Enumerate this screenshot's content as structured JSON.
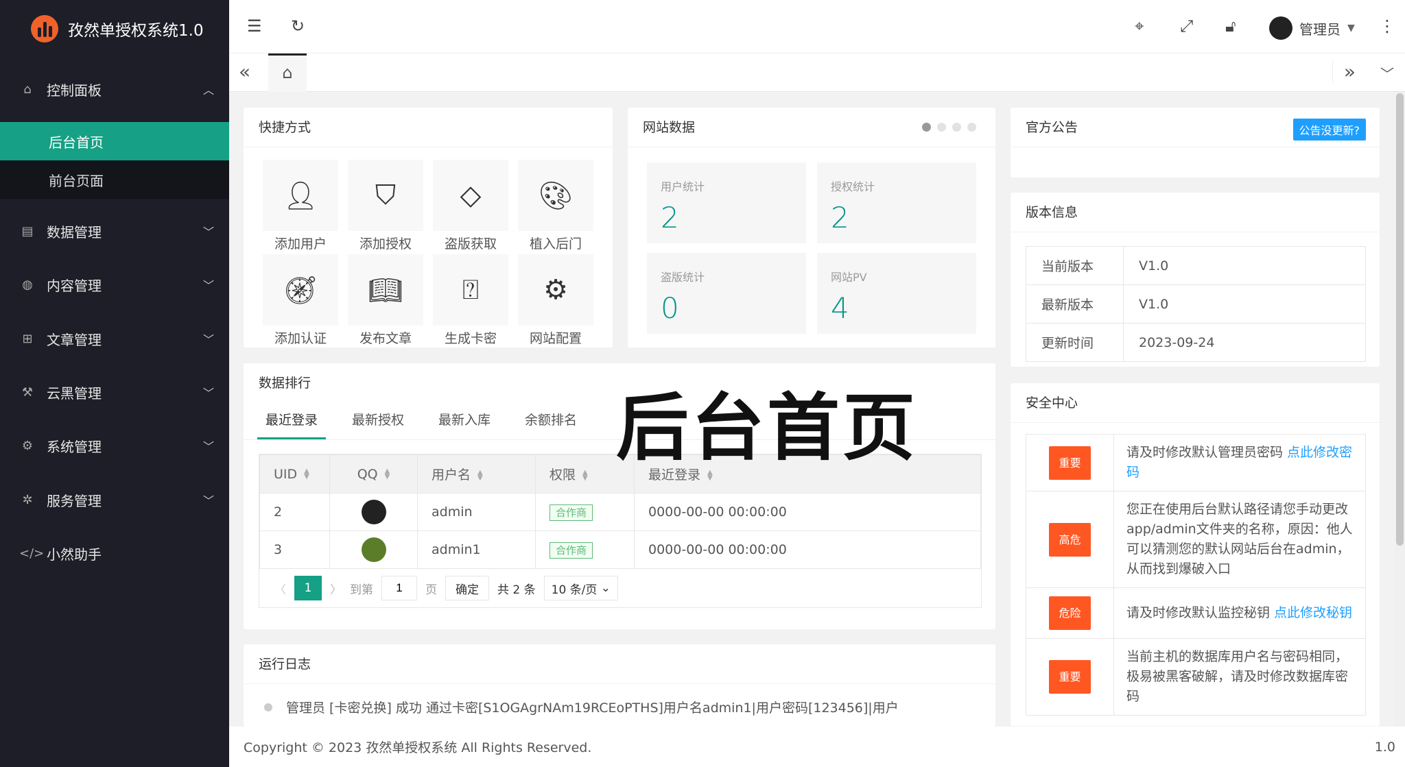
{
  "app": {
    "title": "孜然单授权系统1.0"
  },
  "sidebar": {
    "group": {
      "label": "控制面板",
      "icon": "home-icon"
    },
    "sub_items": [
      {
        "label": "后台首页",
        "active": true
      },
      {
        "label": "前台页面",
        "active": false
      }
    ],
    "items": [
      {
        "label": "数据管理",
        "icon": "file-icon"
      },
      {
        "label": "内容管理",
        "icon": "globe-icon"
      },
      {
        "label": "文章管理",
        "icon": "book-icon"
      },
      {
        "label": "云黑管理",
        "icon": "hammer-icon"
      },
      {
        "label": "系统管理",
        "icon": "gear-icon"
      },
      {
        "label": "服务管理",
        "icon": "service-icon"
      },
      {
        "label": "小然助手",
        "icon": "code-icon"
      }
    ]
  },
  "header": {
    "user": "管理员"
  },
  "quick": {
    "title": "快捷方式",
    "items": [
      {
        "label": "添加用户",
        "icon": "user-icon"
      },
      {
        "label": "添加授权",
        "icon": "shield-check-icon"
      },
      {
        "label": "盗版获取",
        "icon": "diamond-icon"
      },
      {
        "label": "植入后门",
        "icon": "palette-icon"
      },
      {
        "label": "添加认证",
        "icon": "compass-icon"
      },
      {
        "label": "发布文章",
        "icon": "book-open-icon"
      },
      {
        "label": "生成卡密",
        "icon": "question-edit-icon"
      },
      {
        "label": "网站配置",
        "icon": "gear-icon"
      }
    ]
  },
  "site_data": {
    "title": "网站数据",
    "stats": [
      {
        "label": "用户统计",
        "value": "2"
      },
      {
        "label": "授权统计",
        "value": "2"
      },
      {
        "label": "盗版统计",
        "value": "0"
      },
      {
        "label": "网站PV",
        "value": "4"
      }
    ]
  },
  "ranking": {
    "title": "数据排行",
    "tabs": [
      "最近登录",
      "最新授权",
      "最新入库",
      "余额排名"
    ],
    "columns": [
      "UID",
      "QQ",
      "用户名",
      "权限",
      "最近登录"
    ],
    "rows": [
      {
        "uid": "2",
        "username": "admin",
        "role": "合作商",
        "last": "0000-00-00 00:00:00"
      },
      {
        "uid": "3",
        "username": "admin1",
        "role": "合作商",
        "last": "0000-00-00 00:00:00"
      }
    ],
    "pagination": {
      "current": "1",
      "goto_label": "到第",
      "goto_value": "1",
      "page_label": "页",
      "confirm": "确定",
      "total": "共 2 条",
      "page_size": "10 条/页"
    }
  },
  "overlay_title": "后台首页",
  "log": {
    "title": "运行日志",
    "entries": [
      "管理员 [卡密兑换] 成功 通过卡密[S1OGAgrNAm19RCEoPTHS]用户名admin1|用户密码[123456]|用户"
    ]
  },
  "notice": {
    "title": "官方公告",
    "button": "公告没更新?"
  },
  "version": {
    "title": "版本信息",
    "rows": [
      {
        "k": "当前版本",
        "v": "V1.0"
      },
      {
        "k": "最新版本",
        "v": "V1.0"
      },
      {
        "k": "更新时间",
        "v": "2023-09-24"
      }
    ]
  },
  "security": {
    "title": "安全中心",
    "rows": [
      {
        "badge": "重要",
        "text": "请及时修改默认管理员密码 ",
        "link": "点此修改密码"
      },
      {
        "badge": "高危",
        "text": "您正在使用后台默认路径请您手动更改app/admin文件夹的名称，原因：他人可以猜测您的默认网站后台在admin，从而找到爆破入口",
        "link": ""
      },
      {
        "badge": "危险",
        "text": "请及时修改默认监控秘钥 ",
        "link": "点此修改秘钥"
      },
      {
        "badge": "重要",
        "text": "当前主机的数据库用户名与密码相同，极易被黑客破解，请及时修改数据库密码",
        "link": ""
      }
    ]
  },
  "footer": {
    "copyright": "Copyright © 2023 孜然单授权系统 All Rights Reserved.",
    "version": "1.0"
  },
  "colors": {
    "accent": "#16a085",
    "danger": "#ff5722",
    "link": "#1e9fff",
    "sidebar": "#1d1e27"
  }
}
